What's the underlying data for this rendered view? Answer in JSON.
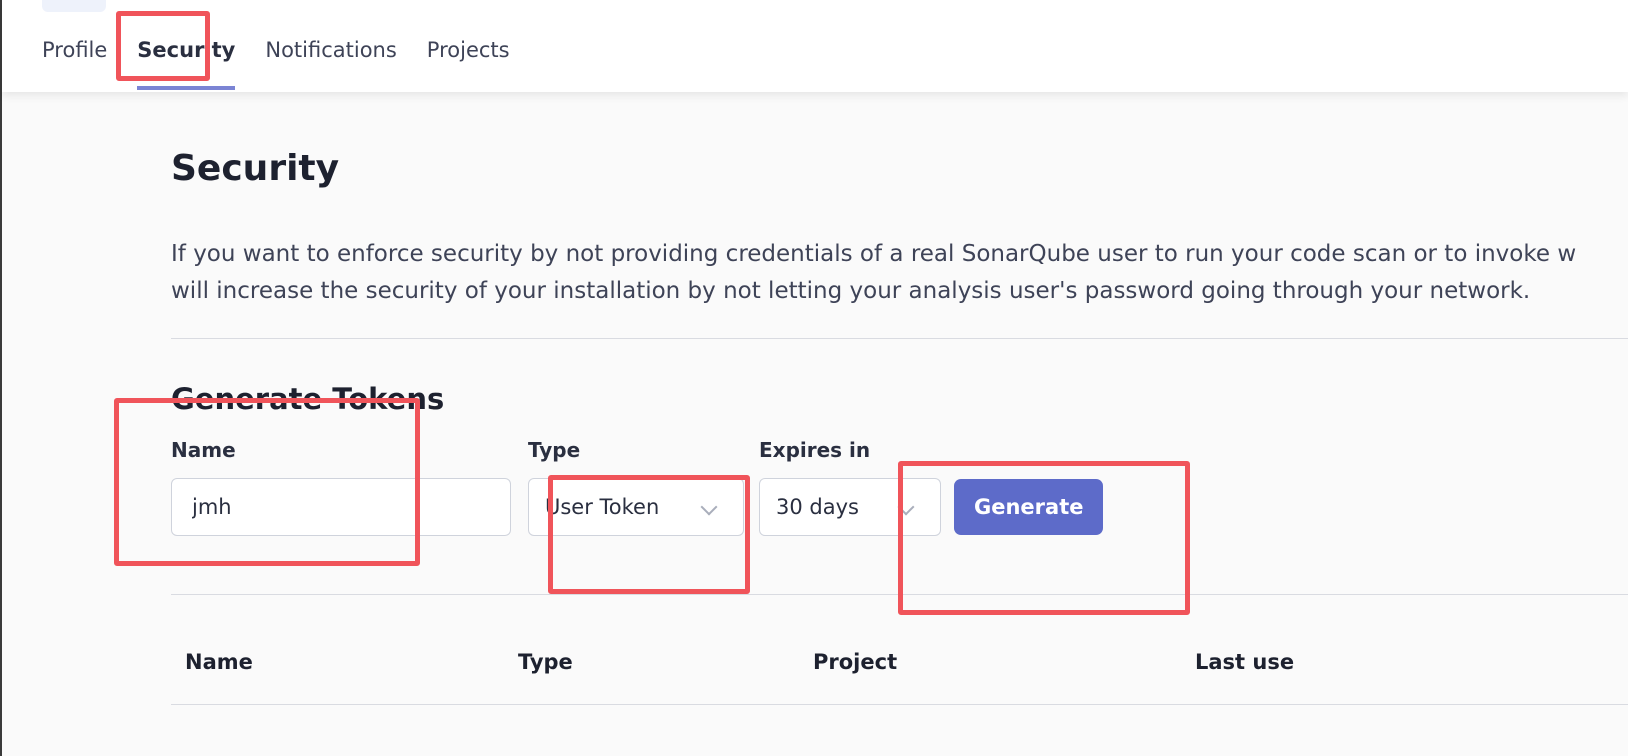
{
  "tabs": [
    {
      "label": "Profile",
      "active": false
    },
    {
      "label": "Security",
      "active": true
    },
    {
      "label": "Notifications",
      "active": false
    },
    {
      "label": "Projects",
      "active": false
    }
  ],
  "page": {
    "title": "Security",
    "description_line1": "If you want to enforce security by not providing credentials of a real SonarQube user to run your code scan or to invoke w",
    "description_line2": "will increase the security of your installation by not letting your analysis user's password going through your network."
  },
  "generate": {
    "title": "Generate Tokens",
    "name_label": "Name",
    "name_value": "jmh",
    "type_label": "Type",
    "type_value": "User Token",
    "expires_label": "Expires in",
    "expires_value": "30 days",
    "button_label": "Generate"
  },
  "table": {
    "columns": [
      "Name",
      "Type",
      "Project",
      "Last use"
    ]
  },
  "colors": {
    "accent": "#5d6bc9",
    "tab_underline": "#7b84d4",
    "annotation": "#f0545a"
  }
}
